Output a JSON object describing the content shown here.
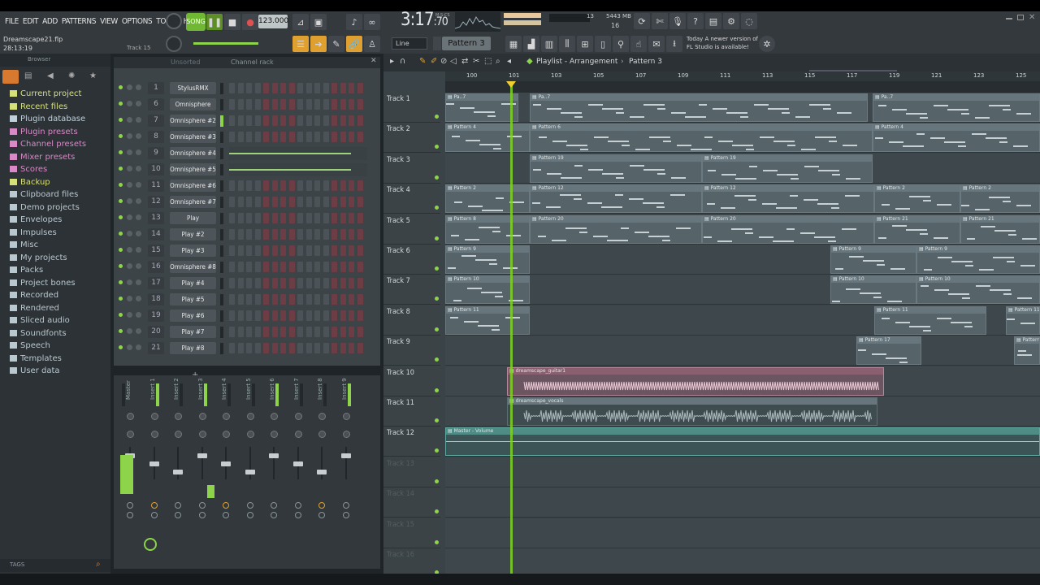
{
  "menu": [
    "FILE",
    "EDIT",
    "ADD",
    "PATTERNS",
    "VIEW",
    "OPTIONS",
    "TOOLS",
    "HELP"
  ],
  "transport": {
    "song_label": "SONG",
    "tempo": "123.000",
    "time": "3:17",
    "time_frac": ":70",
    "time_unit": "M:S:CS",
    "cpu": "13",
    "memory": "5443 MB",
    "voices": "16"
  },
  "project": {
    "filename": "Dreamscape21.flp",
    "elapsed": "28:13:19",
    "hint_track": "Track 15"
  },
  "pattern": {
    "current": "Pattern 3",
    "snap": "Line"
  },
  "news": {
    "line1": "Today  A newer version of",
    "line2": "FL Studio is available!"
  },
  "browser": {
    "title": "Browser",
    "items": [
      {
        "label": "Current project",
        "color": "#d6e07a"
      },
      {
        "label": "Recent files",
        "color": "#d6e07a"
      },
      {
        "label": "Plugin database",
        "color": "#c0d0da"
      },
      {
        "label": "Plugin presets",
        "color": "#d889c6"
      },
      {
        "label": "Channel presets",
        "color": "#d889c6"
      },
      {
        "label": "Mixer presets",
        "color": "#d889c6"
      },
      {
        "label": "Scores",
        "color": "#d889c6"
      },
      {
        "label": "Backup",
        "color": "#d6e07a"
      },
      {
        "label": "Clipboard files",
        "color": "#b9c8cf"
      },
      {
        "label": "Demo projects",
        "color": "#b9c8cf"
      },
      {
        "label": "Envelopes",
        "color": "#b9c8cf"
      },
      {
        "label": "Impulses",
        "color": "#b9c8cf"
      },
      {
        "label": "Misc",
        "color": "#b9c8cf"
      },
      {
        "label": "My projects",
        "color": "#b9c8cf"
      },
      {
        "label": "Packs",
        "color": "#b9c8cf"
      },
      {
        "label": "Project bones",
        "color": "#b9c8cf"
      },
      {
        "label": "Recorded",
        "color": "#b9c8cf"
      },
      {
        "label": "Rendered",
        "color": "#b9c8cf"
      },
      {
        "label": "Sliced audio",
        "color": "#b9c8cf"
      },
      {
        "label": "Soundfonts",
        "color": "#b9c8cf"
      },
      {
        "label": "Speech",
        "color": "#b9c8cf"
      },
      {
        "label": "Templates",
        "color": "#b9c8cf"
      },
      {
        "label": "User data",
        "color": "#b9c8cf"
      }
    ],
    "tags_label": "TAGS"
  },
  "channel_rack": {
    "title": "Channel rack",
    "filter": "Unsorted",
    "channels": [
      {
        "num": "1",
        "name": "StylusRMX"
      },
      {
        "num": "6",
        "name": "Omnisphere"
      },
      {
        "num": "7",
        "name": "Omnisphere #2"
      },
      {
        "num": "8",
        "name": "Omnisphere #3"
      },
      {
        "num": "9",
        "name": "Omnisphere #4"
      },
      {
        "num": "10",
        "name": "Omnisphere #5"
      },
      {
        "num": "11",
        "name": "Omnisphere #6"
      },
      {
        "num": "12",
        "name": "Omnisphere #7"
      },
      {
        "num": "13",
        "name": "Play"
      },
      {
        "num": "14",
        "name": "Play #2"
      },
      {
        "num": "15",
        "name": "Play #3"
      },
      {
        "num": "16",
        "name": "Omnisphere #8"
      },
      {
        "num": "17",
        "name": "Play #4"
      },
      {
        "num": "18",
        "name": "Play #5"
      },
      {
        "num": "19",
        "name": "Play #6"
      },
      {
        "num": "20",
        "name": "Play #7"
      },
      {
        "num": "21",
        "name": "Play #8"
      }
    ]
  },
  "mixer": {
    "strips": [
      "Master",
      "Insert 1",
      "Insert 2",
      "Insert 3",
      "Insert 4",
      "Insert 5",
      "Insert 6",
      "Insert 7",
      "Insert 8",
      "Insert 9"
    ]
  },
  "playlist": {
    "title": "Playlist - Arrangement",
    "pattern": "Pattern 3",
    "ruler": [
      "100",
      "101",
      "103",
      "105",
      "107",
      "109",
      "111",
      "113",
      "115",
      "117",
      "119",
      "121",
      "123",
      "125"
    ],
    "tracks": [
      {
        "name": "Track 1",
        "clips": [
          {
            "label": "Pa..7"
          },
          {
            "label": "Pa..7"
          },
          {
            "label": "Pa..7"
          }
        ]
      },
      {
        "name": "Track 2",
        "clips": [
          {
            "label": "Pattern 4"
          },
          {
            "label": "Pattern 6"
          },
          {
            "label": "Pattern 4"
          }
        ]
      },
      {
        "name": "Track 3",
        "clips": [
          {
            "label": "Pattern 19"
          },
          {
            "label": "Pattern 19"
          }
        ]
      },
      {
        "name": "Track 4",
        "clips": [
          {
            "label": "Pattern 2"
          },
          {
            "label": "Pattern 12"
          },
          {
            "label": "Pattern 12"
          },
          {
            "label": "Pattern 2"
          },
          {
            "label": "Pattern 2"
          }
        ]
      },
      {
        "name": "Track 5",
        "clips": [
          {
            "label": "Pattern 8"
          },
          {
            "label": "Pattern 20"
          },
          {
            "label": "Pattern 20"
          },
          {
            "label": "Pattern 21"
          },
          {
            "label": "Pattern 21"
          }
        ]
      },
      {
        "name": "Track 6",
        "clips": [
          {
            "label": "Pattern 9"
          },
          {
            "label": "Pattern 9"
          },
          {
            "label": "Pattern 9"
          }
        ]
      },
      {
        "name": "Track 7",
        "clips": [
          {
            "label": "Pattern 10"
          },
          {
            "label": "Pattern 10"
          },
          {
            "label": "Pattern 10"
          }
        ]
      },
      {
        "name": "Track 8",
        "clips": [
          {
            "label": "Pattern 11"
          },
          {
            "label": "Pattern 11"
          },
          {
            "label": "Pattern 11"
          }
        ]
      },
      {
        "name": "Track 9",
        "clips": [
          {
            "label": "Pattern 17"
          },
          {
            "label": "Pattern"
          }
        ]
      },
      {
        "name": "Track 10",
        "clips": [
          {
            "label": "dreamscape_guitar1"
          }
        ]
      },
      {
        "name": "Track 11",
        "clips": [
          {
            "label": "dreamscape_vocals"
          }
        ]
      },
      {
        "name": "Track 12",
        "clips": [
          {
            "label": "Master - Volume"
          }
        ]
      },
      {
        "name": "Track 13",
        "clips": []
      },
      {
        "name": "Track 14",
        "clips": []
      },
      {
        "name": "Track 15",
        "clips": []
      },
      {
        "name": "Track 16",
        "clips": []
      }
    ]
  },
  "colors": {
    "accent_green": "#8dd44a",
    "playhead": "#7ed321",
    "audio_guitar": "#b8889c",
    "audio_vocal": "#5c6f73",
    "automation": "#5ea8a0"
  }
}
